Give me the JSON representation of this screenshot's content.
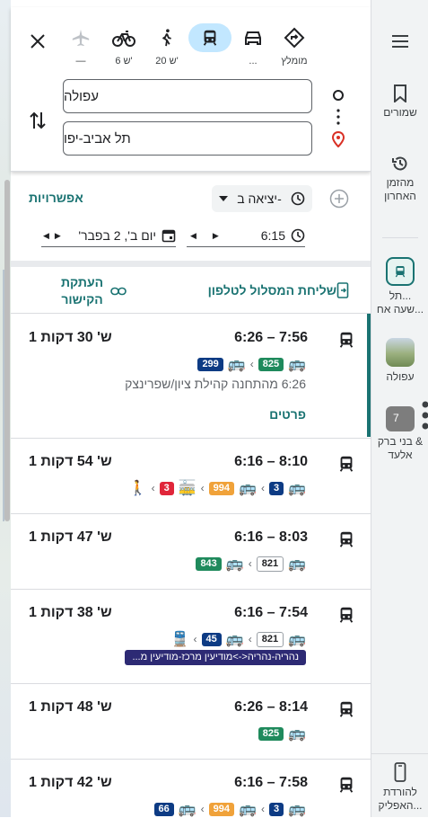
{
  "origin": {
    "value": "עפולה"
  },
  "destination": {
    "value": "תל אביב-יפו"
  },
  "modes": [
    {
      "name": "recommended",
      "label": "מומלץ"
    },
    {
      "name": "car",
      "label": "..."
    },
    {
      "name": "transit",
      "label": ""
    },
    {
      "name": "walk",
      "label": "20 ש'"
    },
    {
      "name": "bike",
      "label": "6 ש'"
    },
    {
      "name": "flight",
      "label": "—"
    }
  ],
  "options": {
    "link": "אפשרויות",
    "depart_label": "יציאה ב-",
    "time": "6:15",
    "date": "יום ב', 2 בפבר'"
  },
  "actions": {
    "send_to_phone": "שליחת המסלול לטלפון",
    "copy_link_1": "העתקת",
    "copy_link_2": "הקישור"
  },
  "routes": [
    {
      "times": "6:26 – 7:56",
      "duration": "1 ש' 30 דקות",
      "detail": "6:26 מהתחנה קהילת ציון/שפרינצק",
      "more": "פרטים"
    },
    {
      "times": "6:16 – 8:10",
      "duration": "1 ש' 54 דקות"
    },
    {
      "times": "6:16 – 8:03",
      "duration": "1 ש' 47 דקות"
    },
    {
      "times": "6:16 – 7:54",
      "duration": "1 ש' 38 דקות",
      "train_line": "נהריה-נהריה<->מודיעין מרכז-מודיעין מ..."
    },
    {
      "times": "6:26 – 8:14",
      "duration": "1 ש' 48 דקות"
    },
    {
      "times": "6:16 – 7:58",
      "duration": "1 ש' 42 דקות"
    }
  ],
  "line_numbers": {
    "r1": [
      "825",
      "299"
    ],
    "r2": [
      "3",
      "994",
      "3"
    ],
    "r3": [
      "821",
      "843"
    ],
    "r4": [
      "821",
      "45"
    ],
    "r5": [
      "825"
    ],
    "r6": [
      "3",
      "994",
      "66"
    ]
  },
  "sidebar": {
    "saved": "שמורים",
    "history_1": "מהזמן",
    "history_2": "האחרון",
    "recent1_1": "תל...",
    "recent1_2": "שעה אח...",
    "recent2": "עפולה",
    "recent3_1": "בני ברק &",
    "recent3_2": "אלעד",
    "recent3_badge": "7",
    "download_1": "להורדת",
    "download_2": "האפליק..."
  },
  "colors": {
    "accent": "#1a7372",
    "selected_mode": "#c2e7ff",
    "destination_pin": "#d93025"
  }
}
